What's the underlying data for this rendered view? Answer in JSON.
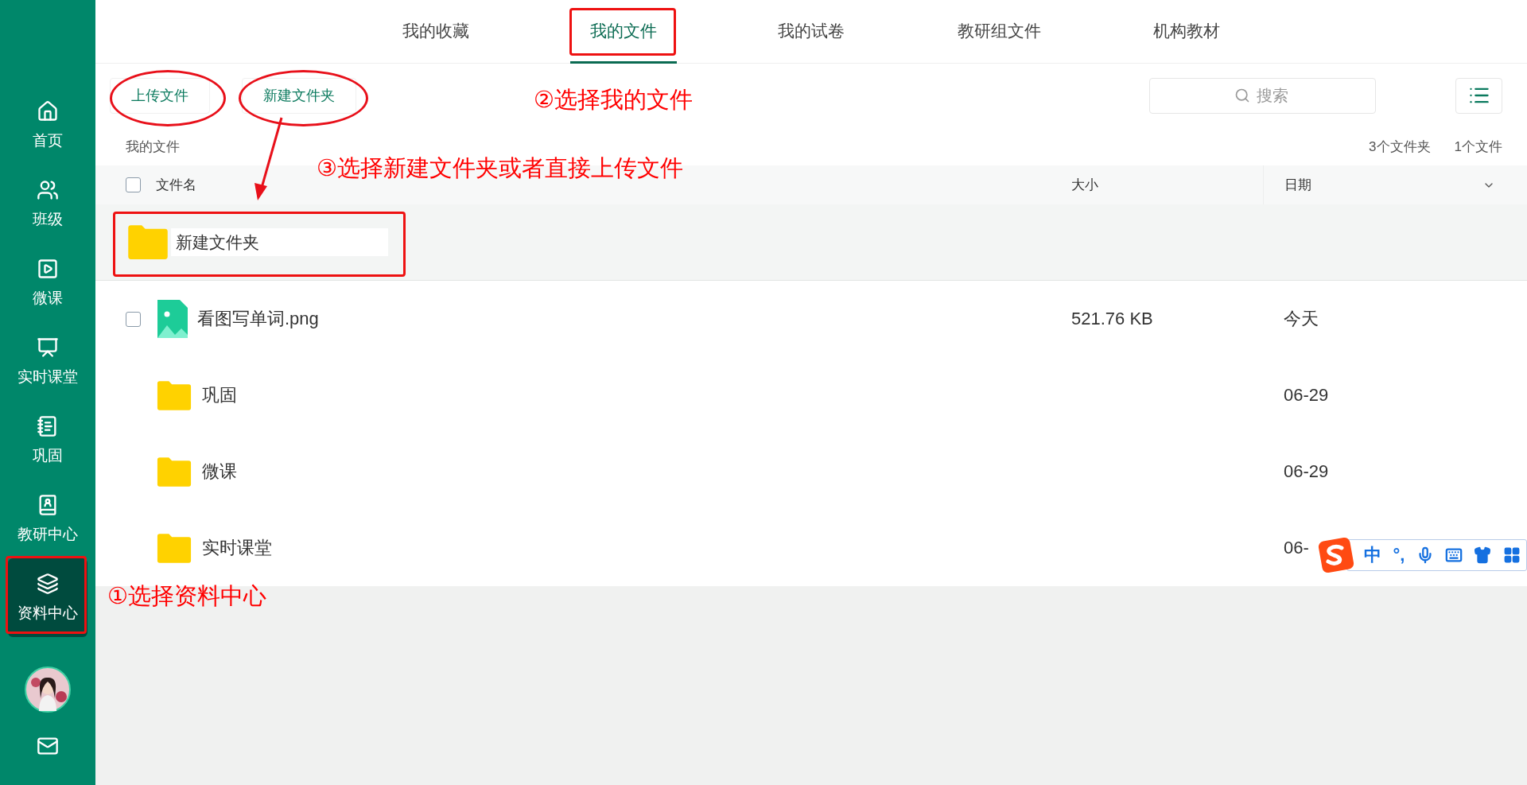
{
  "sidebar": {
    "items": [
      {
        "label": "首页",
        "selected": false
      },
      {
        "label": "班级",
        "selected": false
      },
      {
        "label": "微课",
        "selected": false
      },
      {
        "label": "实时课堂",
        "selected": false
      },
      {
        "label": "巩固",
        "selected": false
      },
      {
        "label": "教研中心",
        "selected": false
      },
      {
        "label": "资料中心",
        "selected": true
      }
    ]
  },
  "nav_tabs": [
    {
      "label": "我的收藏",
      "selected": false
    },
    {
      "label": "我的文件",
      "selected": true
    },
    {
      "label": "我的试卷",
      "selected": false
    },
    {
      "label": "教研组文件",
      "selected": false
    },
    {
      "label": "机构教材",
      "selected": false
    }
  ],
  "toolbar": {
    "buttons": [
      "上传文件",
      "新建文件夹"
    ],
    "search": {
      "placeholder": "搜索"
    }
  },
  "breadcrumb": "我的文件",
  "counts": [
    "3个文件夹",
    "1个文件"
  ],
  "table": {
    "columns": [
      "文件名",
      "大小",
      "日期"
    ],
    "all_checked": false,
    "new_folder": {
      "value": "新建文件夹"
    },
    "rows": [
      {
        "kind": "image",
        "name": "看图写单词.png",
        "size": "521.76 KB",
        "date": "今天",
        "checked": false
      },
      {
        "kind": "folder",
        "name": "巩固",
        "date": "06-29"
      },
      {
        "kind": "folder",
        "name": "微课",
        "date": "06-29"
      },
      {
        "kind": "folder",
        "name": "实时课堂",
        "date": "06-"
      }
    ]
  },
  "ime_bar": {
    "mode": "中",
    "punctuation": "°,"
  },
  "annotations": [
    {
      "text": "①选择资料中心"
    },
    {
      "text": "②选择我的文件"
    },
    {
      "text": "③选择新建文件夹或者直接上传文件"
    }
  ]
}
